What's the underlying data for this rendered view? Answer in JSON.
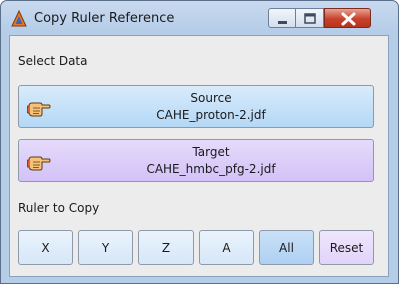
{
  "window": {
    "title": "Copy Ruler Reference"
  },
  "sections": {
    "select_data": "Select Data",
    "ruler_to_copy": "Ruler to Copy"
  },
  "source": {
    "label": "Source",
    "file": "CAHE_proton-2.jdf"
  },
  "target": {
    "label": "Target",
    "file": "CAHE_hmbc_pfg-2.jdf"
  },
  "ruler_buttons": {
    "x": "X",
    "y": "Y",
    "z": "Z",
    "a": "A",
    "all": "All",
    "reset": "Reset"
  },
  "colors": {
    "source_button": "#b4d8f6",
    "target_button": "#d3c2f7",
    "close_button": "#c7422c"
  },
  "icons": {
    "app": "delta-nmr-app-icon",
    "source": "pointing-hand-icon",
    "target": "pointing-hand-icon"
  }
}
